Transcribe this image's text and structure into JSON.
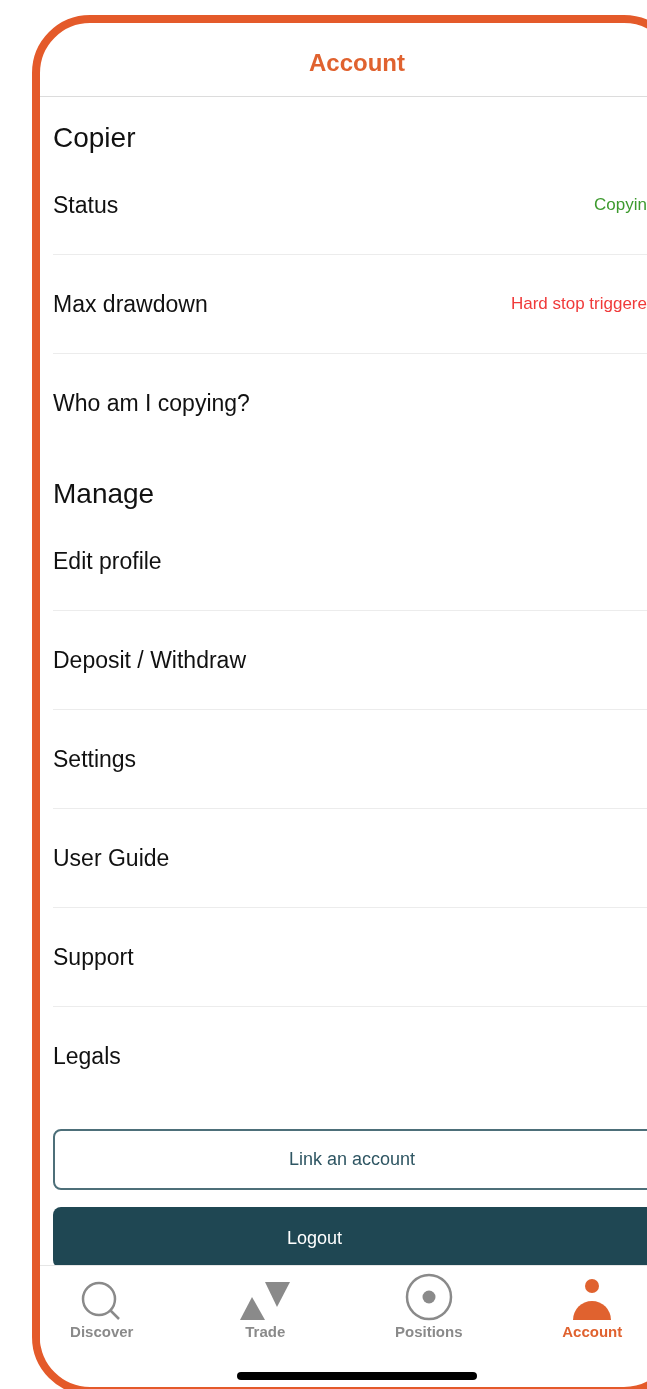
{
  "header": {
    "title": "Account"
  },
  "sections": [
    {
      "title": "Copier",
      "rows": [
        {
          "label": "Status",
          "value": "Copyin",
          "color": "#3d9a2e"
        },
        {
          "label": "Max drawdown",
          "value": "Hard stop triggere",
          "color": "#f03a3a"
        },
        {
          "label": "Who am I copying?"
        }
      ]
    },
    {
      "title": "Manage",
      "rows": [
        {
          "label": "Edit profile"
        },
        {
          "label": "Deposit / Withdraw"
        },
        {
          "label": "Settings"
        },
        {
          "label": "User Guide"
        },
        {
          "label": "Support"
        },
        {
          "label": "Legals"
        }
      ]
    }
  ],
  "buttons": [
    {
      "label": "Link an account",
      "kind": "outline"
    },
    {
      "label": "Logout",
      "kind": "filled"
    }
  ],
  "tab_bar": [
    {
      "label": "Discover",
      "selected": false
    },
    {
      "label": "Trade",
      "selected": false
    },
    {
      "label": "Positions",
      "selected": false
    },
    {
      "label": "Account",
      "selected": true
    }
  ]
}
